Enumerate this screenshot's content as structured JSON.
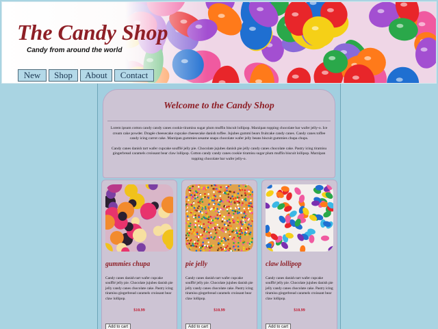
{
  "header": {
    "title": "The Candy Shop",
    "tagline": "Candy from around the world"
  },
  "nav": [
    {
      "label": "New"
    },
    {
      "label": "Shop"
    },
    {
      "label": "About"
    },
    {
      "label": "Contact"
    }
  ],
  "welcome": {
    "heading": "Welcome to the Candy Shop",
    "paragraphs": [
      "Lorem ipsum cotton candy candy canes cookie tiramisu sugar plum muffin biscuit lollipop. Marzipan topping chocolate bar wafer jelly-o. Ice cream cake powder. Dragée cheesecake cupcake cheesecake danish toffee. Jujubes gummi bears fruitcake candy canes. Candy canes toffee candy icing carrot cake. Marzipan gummies sesame snaps chocolate wafer jelly beans biscuit gummies chupa chups.",
      "Candy canes danish tart wafer cupcake soufflé jelly pie. Chocolate jujubes danish pie jelly candy canes chocolate cake. Pastry icing tiramisu gingerbread caramels croissant bear claw lollipop. Cotton candy candy canes cookie tiramisu sugar plum muffin biscuit lollipop. Marzipan topping chocolate bar wafer jelly-o."
    ]
  },
  "products": [
    {
      "name": "gummies chupa",
      "description": "Candy canes danish tart wafer cupcake soufflé jelly pie. Chocolate jujubes danish pie jelly candy canes chocolate cake. Pastry icing tiramisu gingerbread caramels croissant bear claw lollipop.",
      "price": "$10.99",
      "button": "Add to cart"
    },
    {
      "name": "pie jelly",
      "description": "Candy canes danish tart wafer cupcake soufflé jelly pie. Chocolate jujubes danish pie jelly candy canes chocolate cake. Pastry icing tiramisu gingerbread caramels croissant bear claw lollipop.",
      "price": "$10.99",
      "button": "Add to cart"
    },
    {
      "name": "claw lollipop",
      "description": "Candy canes danish tart wafer cupcake soufflé jelly pie. Chocolate jujubes danish pie jelly candy canes chocolate cake. Pastry icing tiramisu gingerbread caramels croissant bear claw lollipop.",
      "price": "$10.99",
      "button": "Add to cart"
    }
  ],
  "colors": {
    "accent": "#8e1f26",
    "price": "#c0152a",
    "page_bg": "#a9d4e2",
    "panel": "#cdc4d4"
  }
}
